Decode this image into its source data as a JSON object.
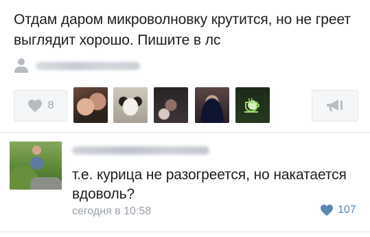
{
  "post": {
    "text": "Отдам даром микроволновку крутится, но не греет выглядит хорошо. Пишите в лс",
    "author_icon": "person-icon",
    "likes": {
      "count": "8",
      "icon": "heart-icon",
      "color": "#b7bcc3"
    },
    "liked_by_avatars": [
      "avatar-1",
      "avatar-2",
      "avatar-3",
      "avatar-4",
      "avatar-5"
    ],
    "share_icon": "megaphone-icon"
  },
  "comment": {
    "text": "т.е. курица не разогреется, но накатается вдоволь?",
    "timestamp": "сегодня в 10:58",
    "likes": {
      "count": "107",
      "icon": "heart-icon",
      "color": "#5b87b8"
    }
  }
}
